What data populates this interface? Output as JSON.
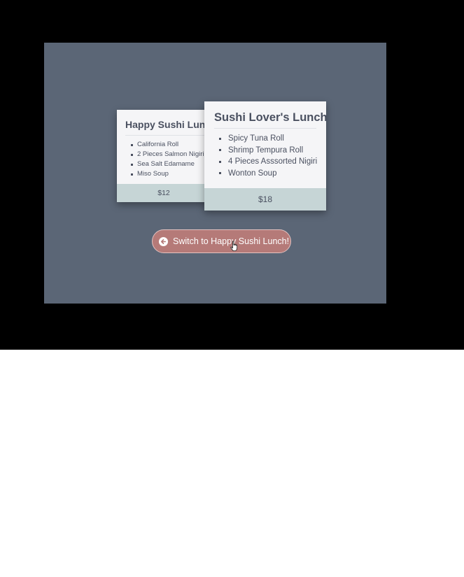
{
  "colors": {
    "frame_background": "#000000",
    "stage_background": "#5b6676",
    "card_background": "#f5f5f7",
    "price_bar": "#c6d5d6",
    "button_background": "#b57a78",
    "text": "#4a5060"
  },
  "cards": [
    {
      "title": "Happy Sushi Lunch",
      "items": [
        "California Roll",
        "2 Pieces Salmon Nigiri",
        "Sea Salt Edamame",
        "Miso Soup"
      ],
      "price": "$12"
    },
    {
      "title": "Sushi Lover's Lunch",
      "items": [
        "Spicy Tuna Roll",
        "Shrimp Tempura Roll",
        "4 Pieces Asssorted Nigiri",
        "Wonton Soup"
      ],
      "price": "$18"
    }
  ],
  "switch_button": {
    "label": "Switch to Happy Sushi Lunch!",
    "icon": "arrow-left-circle-icon"
  },
  "cursor": {
    "icon": "hand-pointer-icon"
  }
}
